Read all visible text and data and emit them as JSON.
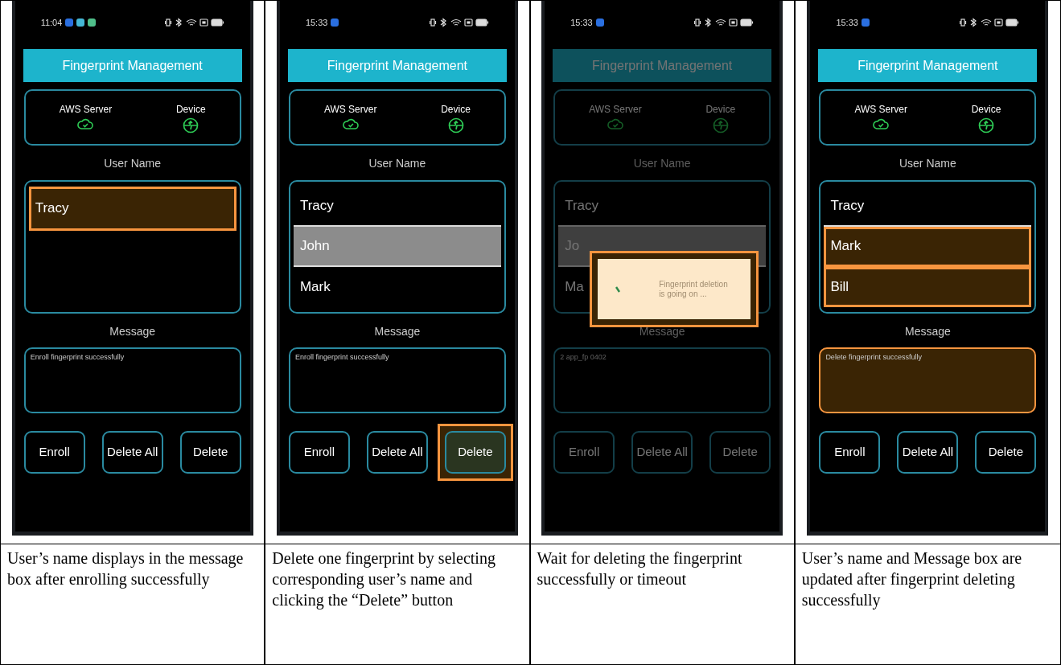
{
  "panels": [
    {
      "phone": {
        "time": "11:04",
        "notifications": [
          {
            "color": "#2a6fe0"
          },
          {
            "color": "#45b8d6"
          },
          {
            "color": "#4fbf8a"
          }
        ],
        "dimmed": false,
        "title": "Fingerprint Management",
        "server_label": "AWS Server",
        "device_label": "Device",
        "user_label": "User Name",
        "users": [
          {
            "name": "Tracy",
            "selected": false,
            "highlighted": true
          }
        ],
        "message_label": "Message",
        "message": {
          "text": "Enroll fingerprint successfully",
          "highlighted": false
        },
        "buttons": [
          {
            "label": "Enroll",
            "highlighted": false
          },
          {
            "label": "Delete All",
            "highlighted": false
          },
          {
            "label": "Delete",
            "highlighted": false
          }
        ]
      },
      "caption": "User’s name displays in the message box after enrolling successfully"
    },
    {
      "phone": {
        "time": "15:33",
        "notifications": [
          {
            "color": "#2a6fe0"
          }
        ],
        "dimmed": false,
        "title": "Fingerprint Management",
        "server_label": "AWS Server",
        "device_label": "Device",
        "user_label": "User Name",
        "users": [
          {
            "name": "Tracy",
            "selected": false,
            "highlighted": false
          },
          {
            "name": "John",
            "selected": true,
            "highlighted": false
          },
          {
            "name": "Mark",
            "selected": false,
            "highlighted": false
          }
        ],
        "message_label": "Message",
        "message": {
          "text": "Enroll fingerprint successfully",
          "highlighted": false
        },
        "buttons": [
          {
            "label": "Enroll",
            "highlighted": false
          },
          {
            "label": "Delete All",
            "highlighted": false
          },
          {
            "label": "Delete",
            "highlighted": true
          }
        ]
      },
      "caption": "Delete one fingerprint by selecting corresponding user’s name and clicking the “Delete” button"
    },
    {
      "phone": {
        "time": "15:33",
        "notifications": [
          {
            "color": "#2a6fe0"
          }
        ],
        "dimmed": true,
        "title": "Fingerprint Management",
        "server_label": "AWS Server",
        "device_label": "Device",
        "user_label": "User Name",
        "users": [
          {
            "name": "Tracy",
            "selected": false,
            "highlighted": false
          },
          {
            "name": "Jo",
            "selected": true,
            "highlighted": false
          },
          {
            "name": "Ma",
            "selected": false,
            "highlighted": false
          }
        ],
        "message_label": "Message",
        "message": {
          "text": "2 app_fp 0402",
          "highlighted": false
        },
        "buttons": [
          {
            "label": "Enroll",
            "highlighted": false
          },
          {
            "label": "Delete All",
            "highlighted": false
          },
          {
            "label": "Delete",
            "highlighted": false
          }
        ],
        "dialog": {
          "text": "Fingerprint deletion is going on ...",
          "highlighted": true
        }
      },
      "caption": "Wait for deleting the fingerprint successfully or timeout"
    },
    {
      "phone": {
        "time": "15:33",
        "notifications": [
          {
            "color": "#2a6fe0"
          }
        ],
        "dimmed": false,
        "title": "Fingerprint Management",
        "server_label": "AWS Server",
        "device_label": "Device",
        "user_label": "User Name",
        "users": [
          {
            "name": "Tracy",
            "selected": false,
            "highlighted": false
          },
          {
            "name": "Mark",
            "selected": false,
            "highlighted": true
          },
          {
            "name": "Bill",
            "selected": false,
            "highlighted": true
          }
        ],
        "message_label": "Message",
        "message": {
          "text": "Delete fingerprint successfully",
          "highlighted": true
        },
        "buttons": [
          {
            "label": "Enroll",
            "highlighted": false
          },
          {
            "label": "Delete All",
            "highlighted": false
          },
          {
            "label": "Delete",
            "highlighted": false
          }
        ]
      },
      "caption": "User’s name and Message box are updated after fingerprint deleting successfully"
    }
  ]
}
